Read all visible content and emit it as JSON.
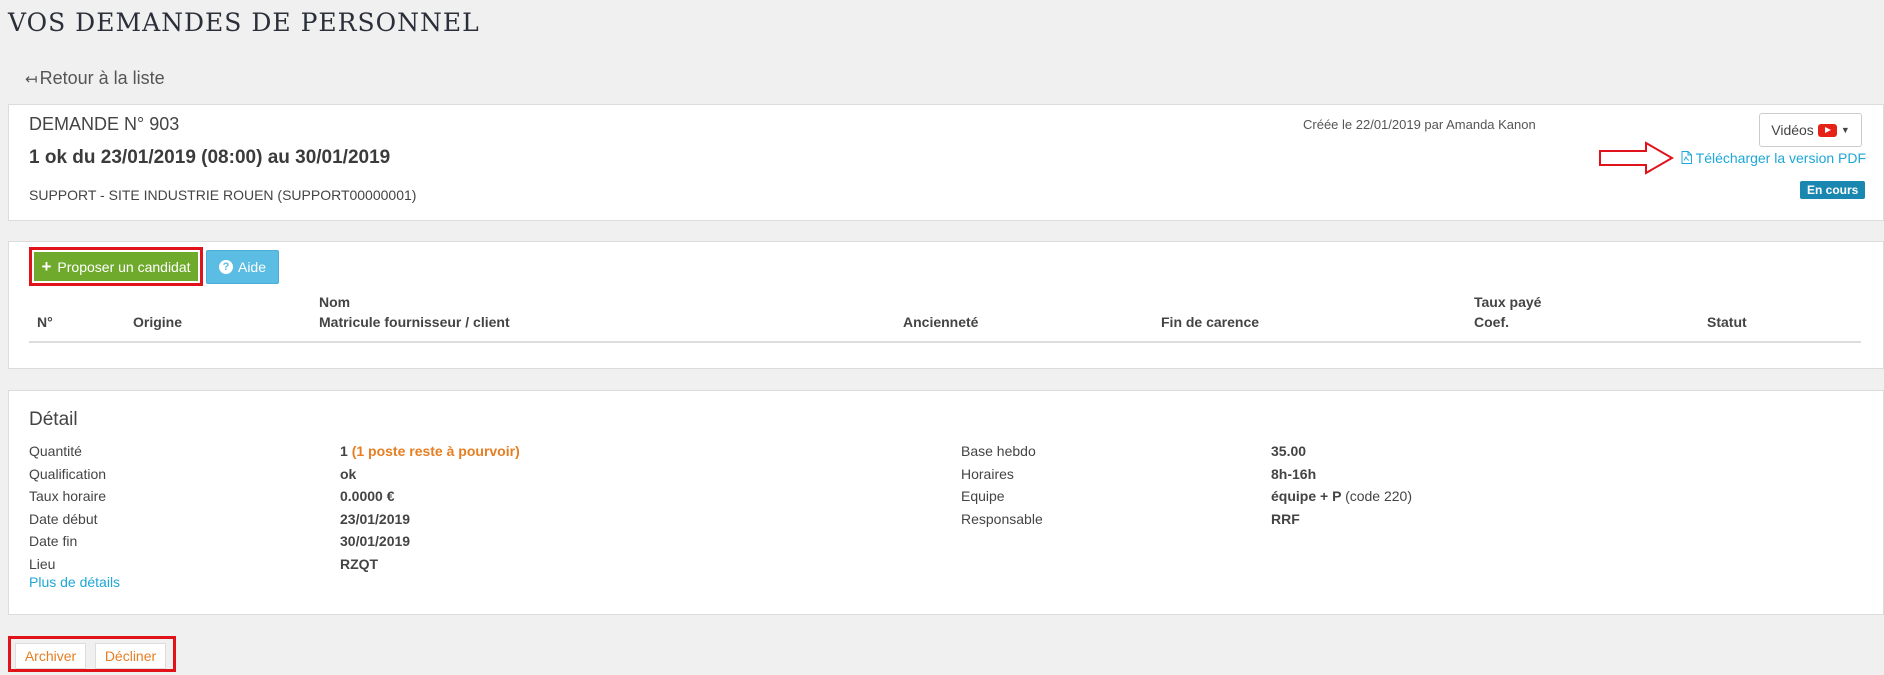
{
  "page": {
    "title": "VOS DEMANDES DE PERSONNEL",
    "back_link": "Retour à la liste"
  },
  "request": {
    "number": "DEMANDE N° 903",
    "dates": "1 ok du 23/01/2019 (08:00) au 30/01/2019",
    "site": "SUPPORT - SITE INDUSTRIE ROUEN (SUPPORT00000001)",
    "created": "Créée le 22/01/2019 par Amanda Kanon",
    "videos_label": "Vidéos",
    "pdf_link": "Télécharger la version PDF",
    "status": "En cours"
  },
  "candidates": {
    "propose_button": "Proposer un candidat",
    "help_button": "Aide",
    "headers": {
      "num": "N°",
      "origin": "Origine",
      "name": "Nom",
      "matricule": "Matricule fournisseur / client",
      "seniority": "Ancienneté",
      "end_waiting": "Fin de carence",
      "rate": "Taux payé",
      "coef": "Coef.",
      "status": "Statut"
    }
  },
  "detail": {
    "title": "Détail",
    "left": [
      {
        "label": "Quantité",
        "value": "1",
        "extra": "(1 poste reste à pourvoir)"
      },
      {
        "label": "Qualification",
        "value": "ok"
      },
      {
        "label": "Taux horaire",
        "value": "0.0000 €"
      },
      {
        "label": "Date début",
        "value": "23/01/2019"
      },
      {
        "label": "Date fin",
        "value": "30/01/2019"
      },
      {
        "label": "Lieu",
        "value": "RZQT"
      }
    ],
    "right": [
      {
        "label": "Base hebdo",
        "value": "35.00"
      },
      {
        "label": "Horaires",
        "value": "8h-16h"
      },
      {
        "label": "Equipe",
        "value": "équipe + P",
        "extra": "(code 220)"
      },
      {
        "label": "Responsable",
        "value": "RRF"
      }
    ],
    "more_link": "Plus de détails"
  },
  "actions": {
    "archive": "Archiver",
    "decline": "Décliner"
  },
  "colors": {
    "accent_link": "#1ea7d8",
    "propose_green": "#6faa2d",
    "help_blue": "#5bbde4",
    "status_blue": "#1a87b0",
    "highlight_red": "#e0131a",
    "orange": "#e67e22"
  }
}
